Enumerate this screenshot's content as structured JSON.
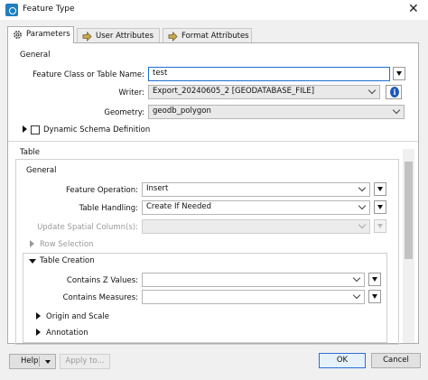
{
  "window": {
    "title": "Feature Type",
    "close_glyph": "✕",
    "app_icon": "fme-app-icon"
  },
  "tabs": [
    {
      "label": "Parameters",
      "icon": "gear-icon",
      "active": true
    },
    {
      "label": "User Attributes",
      "icon": "arrow-icon",
      "active": false
    },
    {
      "label": "Format Attributes",
      "icon": "arrow-icon",
      "active": false
    }
  ],
  "general": {
    "section_label": "General",
    "feature_class_label": "Feature Class or Table Name:",
    "feature_class_value": "test",
    "writer_label": "Writer:",
    "writer_value": "Export_20240605_2 [GEODATABASE_FILE]",
    "geometry_label": "Geometry:",
    "geometry_value": "geodb_polygon",
    "dynamic_schema_label": "Dynamic Schema Definition",
    "dynamic_schema_checked": false
  },
  "table": {
    "section_label": "Table",
    "general_label": "General",
    "feature_operation_label": "Feature Operation:",
    "feature_operation_value": "Insert",
    "table_handling_label": "Table Handling:",
    "table_handling_value": "Create If Needed",
    "update_spatial_label": "Update Spatial Column(s):",
    "update_spatial_value": "",
    "row_selection_label": "Row Selection",
    "table_creation_label": "Table Creation",
    "contains_z_label": "Contains Z Values:",
    "contains_z_value": "",
    "contains_measures_label": "Contains Measures:",
    "contains_measures_value": "",
    "origin_scale_label": "Origin and Scale",
    "annotation_label": "Annotation"
  },
  "footer": {
    "help_label": "Help",
    "apply_label": "Apply to...",
    "ok_label": "OK",
    "cancel_label": "Cancel"
  },
  "colors": {
    "accent": "#1f6fd0",
    "info": "#1d5ab9"
  }
}
